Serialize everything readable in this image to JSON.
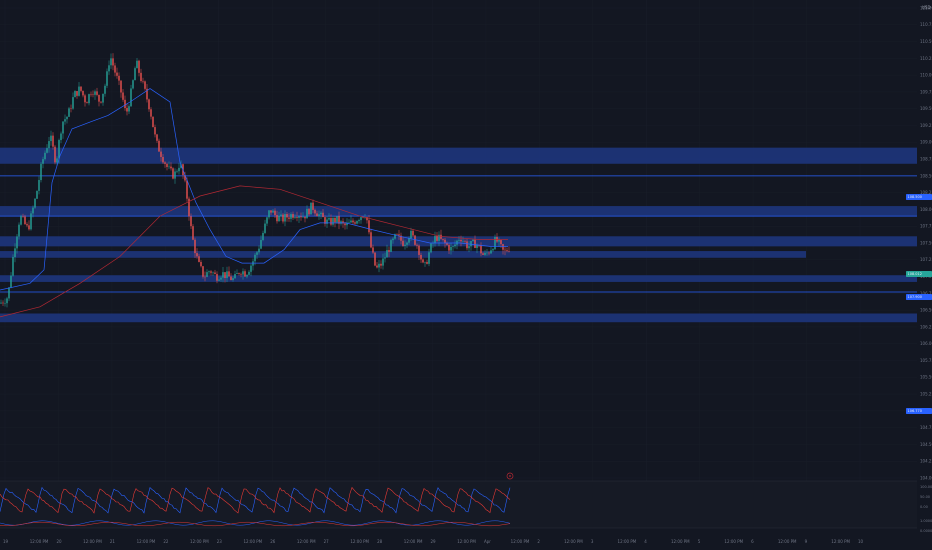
{
  "header": {
    "currency": "USD"
  },
  "colors": {
    "background": "#131722",
    "grid": "#1b1f2b",
    "zone": "#1f3a8a",
    "zone_line": "#2962ff",
    "candle_up": "#26a69a",
    "candle_down": "#ef5350",
    "ma_fast": "#2962ff",
    "ma_slow": "#b22833",
    "price_badge": "#26a69a",
    "level_badge": "#2962ff",
    "osc_blue": "#2962ff",
    "osc_red": "#e53935"
  },
  "price_axis": {
    "ticks": [
      "111.000",
      "110.750",
      "110.500",
      "110.250",
      "110.000",
      "109.750",
      "109.500",
      "109.250",
      "109.000",
      "108.750",
      "108.500",
      "108.250",
      "108.000",
      "107.750",
      "107.500",
      "107.250",
      "107.000",
      "106.750",
      "106.500",
      "106.250",
      "106.000",
      "105.750",
      "105.500",
      "105.250",
      "105.000",
      "104.750",
      "104.500",
      "104.250",
      "104.000"
    ],
    "current_price_badge": "108.012",
    "level_badges": [
      "108.500",
      "107.900",
      "106.770"
    ]
  },
  "indicator_axis": {
    "ticks": [
      "100.00",
      "50.00",
      "0.00",
      "1.0000",
      "0.00000"
    ]
  },
  "time_axis": {
    "labels": [
      "19",
      "12:00 PM",
      "20",
      "12:00 PM",
      "21",
      "12:00 PM",
      "22",
      "12:00 PM",
      "23",
      "12:00 PM",
      "26",
      "12:00 PM",
      "27",
      "12:00 PM",
      "28",
      "12:00 PM",
      "29",
      "12:00 PM",
      "Apr",
      "12:00 PM",
      "2",
      "12:00 PM",
      "3",
      "12:00 PM",
      "4",
      "12:00 PM",
      "5",
      "12:00 PM",
      "6",
      "12:00 PM",
      "9",
      "12:00 PM",
      "10"
    ]
  },
  "chart_data": {
    "type": "candlestick",
    "ylim": [
      104.0,
      111.0
    ],
    "xlabels": [
      "19",
      "20",
      "21",
      "22",
      "23",
      "26",
      "27",
      "28",
      "29",
      "Apr",
      "2",
      "3",
      "4",
      "5",
      "6",
      "9",
      "10"
    ],
    "close_path": [
      [
        0,
        106.6
      ],
      [
        8,
        106.7
      ],
      [
        14,
        107.4
      ],
      [
        20,
        107.9
      ],
      [
        28,
        107.7
      ],
      [
        36,
        108.2
      ],
      [
        42,
        108.7
      ],
      [
        50,
        109.1
      ],
      [
        56,
        108.7
      ],
      [
        62,
        109.3
      ],
      [
        68,
        109.4
      ],
      [
        74,
        109.7
      ],
      [
        80,
        109.8
      ],
      [
        86,
        109.6
      ],
      [
        92,
        109.8
      ],
      [
        100,
        109.6
      ],
      [
        106,
        109.9
      ],
      [
        110,
        110.3
      ],
      [
        116,
        110.0
      ],
      [
        122,
        109.7
      ],
      [
        126,
        109.4
      ],
      [
        132,
        109.8
      ],
      [
        136,
        110.2
      ],
      [
        140,
        110.0
      ],
      [
        146,
        109.7
      ],
      [
        150,
        109.5
      ],
      [
        156,
        109.0
      ],
      [
        162,
        108.8
      ],
      [
        168,
        108.6
      ],
      [
        174,
        108.5
      ],
      [
        180,
        108.7
      ],
      [
        186,
        108.3
      ],
      [
        192,
        107.6
      ],
      [
        198,
        107.2
      ],
      [
        204,
        107.0
      ],
      [
        210,
        107.1
      ],
      [
        216,
        107.0
      ],
      [
        222,
        107.05
      ],
      [
        228,
        107.0
      ],
      [
        234,
        106.95
      ],
      [
        240,
        107.1
      ],
      [
        246,
        107.05
      ],
      [
        252,
        107.2
      ],
      [
        258,
        107.4
      ],
      [
        264,
        107.7
      ],
      [
        270,
        108.0
      ],
      [
        276,
        107.9
      ],
      [
        282,
        107.85
      ],
      [
        288,
        107.9
      ],
      [
        296,
        107.95
      ],
      [
        304,
        107.9
      ],
      [
        312,
        108.05
      ],
      [
        320,
        107.9
      ],
      [
        328,
        107.8
      ],
      [
        336,
        107.85
      ],
      [
        344,
        107.75
      ],
      [
        352,
        107.8
      ],
      [
        360,
        107.9
      ],
      [
        366,
        107.95
      ],
      [
        370,
        107.5
      ],
      [
        376,
        107.1
      ],
      [
        382,
        107.2
      ],
      [
        388,
        107.4
      ],
      [
        396,
        107.6
      ],
      [
        404,
        107.5
      ],
      [
        410,
        107.65
      ],
      [
        418,
        107.45
      ],
      [
        424,
        107.1
      ],
      [
        430,
        107.4
      ],
      [
        436,
        107.6
      ],
      [
        444,
        107.5
      ],
      [
        452,
        107.4
      ],
      [
        460,
        107.6
      ],
      [
        468,
        107.45
      ],
      [
        476,
        107.5
      ],
      [
        484,
        107.3
      ],
      [
        490,
        107.4
      ],
      [
        496,
        107.55
      ],
      [
        504,
        107.35
      ],
      [
        510,
        107.45
      ]
    ],
    "ma_fast": [
      [
        0,
        106.8
      ],
      [
        30,
        106.9
      ],
      [
        44,
        107.1
      ],
      [
        52,
        108.4
      ],
      [
        60,
        108.8
      ],
      [
        72,
        109.2
      ],
      [
        90,
        109.3
      ],
      [
        108,
        109.4
      ],
      [
        130,
        109.6
      ],
      [
        150,
        109.8
      ],
      [
        170,
        109.6
      ],
      [
        180,
        108.7
      ],
      [
        196,
        108.1
      ],
      [
        210,
        107.7
      ],
      [
        226,
        107.3
      ],
      [
        242,
        107.2
      ],
      [
        264,
        107.2
      ],
      [
        284,
        107.4
      ],
      [
        300,
        107.7
      ],
      [
        320,
        107.8
      ],
      [
        346,
        107.8
      ],
      [
        372,
        107.7
      ],
      [
        400,
        107.6
      ],
      [
        430,
        107.5
      ],
      [
        460,
        107.5
      ],
      [
        490,
        107.45
      ],
      [
        508,
        107.45
      ]
    ],
    "ma_slow": [
      [
        0,
        106.4
      ],
      [
        40,
        106.55
      ],
      [
        80,
        106.9
      ],
      [
        120,
        107.3
      ],
      [
        160,
        107.9
      ],
      [
        200,
        108.2
      ],
      [
        240,
        108.35
      ],
      [
        280,
        108.3
      ],
      [
        320,
        108.1
      ],
      [
        360,
        107.9
      ],
      [
        400,
        107.75
      ],
      [
        440,
        107.6
      ],
      [
        480,
        107.55
      ],
      [
        508,
        107.55
      ]
    ],
    "zones": [
      [
        108.68,
        108.92
      ],
      [
        107.9,
        108.05
      ],
      [
        107.45,
        107.6
      ],
      [
        107.28,
        107.38
      ],
      [
        106.92,
        107.02
      ],
      [
        106.32,
        106.45
      ]
    ],
    "levels": [
      108.5,
      107.9,
      106.77
    ]
  }
}
